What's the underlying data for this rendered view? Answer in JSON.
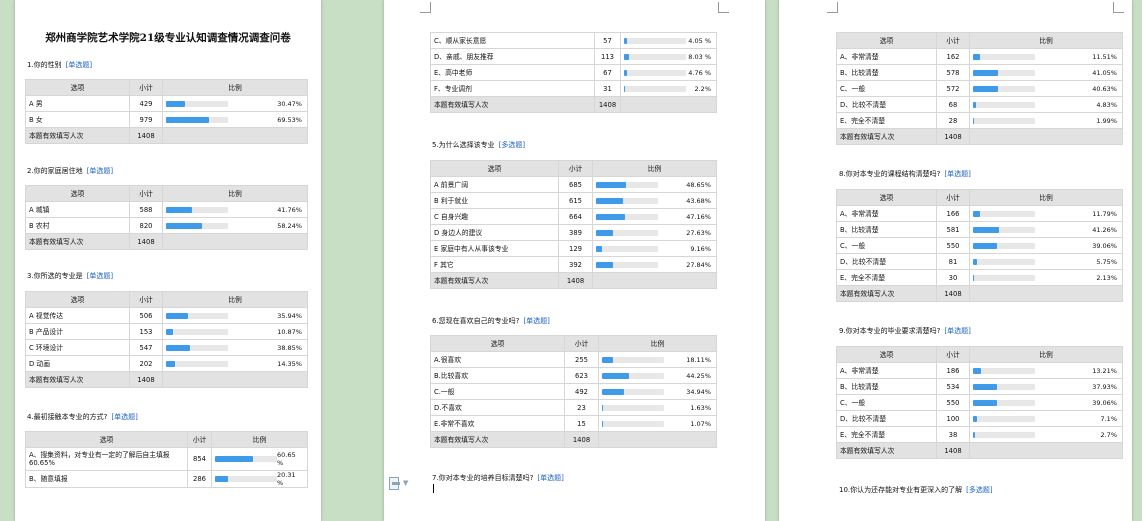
{
  "document": {
    "title": "郑州商学院艺术学院21级专业认知调查情况调查问卷",
    "header_option": "选项",
    "header_count": "小计",
    "header_ratio": "比例",
    "total_label": "本题有效填写人次"
  },
  "colors": {
    "bar_fill": "#3d9be9",
    "bar_track": "#e7e7e7",
    "tag": "#1a5fc7",
    "background": "#c9dfc5"
  },
  "icons": {
    "toolbar": "document-icon",
    "dropdown": "chevron-down-icon"
  },
  "questions": {
    "q1": {
      "title": "1.你的性别",
      "tag": "[单选题]",
      "total": "1408",
      "rows": [
        {
          "option": "A 男",
          "count": "429",
          "pct": "30.47%",
          "ratio": 30.47
        },
        {
          "option": "B 女",
          "count": "979",
          "pct": "69.53%",
          "ratio": 69.53
        }
      ]
    },
    "q2": {
      "title": "2.你的家庭居住地",
      "tag": "[单选题]",
      "total": "1408",
      "rows": [
        {
          "option": "A 城镇",
          "count": "588",
          "pct": "41.76%",
          "ratio": 41.76
        },
        {
          "option": "B 农村",
          "count": "820",
          "pct": "58.24%",
          "ratio": 58.24
        }
      ]
    },
    "q3": {
      "title": "3.你所选的专业是",
      "tag": "[单选题]",
      "total": "1408",
      "rows": [
        {
          "option": "A 视觉传达",
          "count": "506",
          "pct": "35.94%",
          "ratio": 35.94
        },
        {
          "option": "B 产品设计",
          "count": "153",
          "pct": "10.87%",
          "ratio": 10.87
        },
        {
          "option": "C 环境设计",
          "count": "547",
          "pct": "38.85%",
          "ratio": 38.85
        },
        {
          "option": "D 动画",
          "count": "202",
          "pct": "14.35%",
          "ratio": 14.35
        }
      ]
    },
    "q4": {
      "title": "4.最初接触本专业的方式?",
      "tag": "[单选题]",
      "rows": [
        {
          "option": "A、搜集资料，对专业有一定的了解后自主填报 60.65%",
          "count": "854",
          "pct": "60.65 %",
          "ratio": 60.65
        },
        {
          "option": "B、随意填报",
          "count": "286",
          "pct": "20.31 %",
          "ratio": 20.31
        }
      ],
      "rows_cont": [
        {
          "option": "C、顺从家长意愿",
          "count": "57",
          "pct": "4.05 %",
          "ratio": 4.05
        },
        {
          "option": "D、亲戚、朋友推荐",
          "count": "113",
          "pct": "8.03 %",
          "ratio": 8.03
        },
        {
          "option": "E、高中老师",
          "count": "67",
          "pct": "4.76 %",
          "ratio": 4.76
        },
        {
          "option": "F、专业调剂",
          "count": "31",
          "pct": "2.2%",
          "ratio": 2.2
        }
      ],
      "total": "1408"
    },
    "q5": {
      "title": "5.为什么选择该专业",
      "tag": "[多选题]",
      "total": "1408",
      "rows": [
        {
          "option": "A 前景广阔",
          "count": "685",
          "pct": "48.65%",
          "ratio": 48.65
        },
        {
          "option": "B 利于就业",
          "count": "615",
          "pct": "43.68%",
          "ratio": 43.68
        },
        {
          "option": "C 自身兴趣",
          "count": "664",
          "pct": "47.16%",
          "ratio": 47.16
        },
        {
          "option": "D 身边人的建议",
          "count": "389",
          "pct": "27.63%",
          "ratio": 27.63
        },
        {
          "option": "E 家庭中有人从事该专业",
          "count": "129",
          "pct": "9.16%",
          "ratio": 9.16
        },
        {
          "option": "F 其它",
          "count": "392",
          "pct": "27.84%",
          "ratio": 27.84
        }
      ]
    },
    "q6": {
      "title": "6.您现在喜欢自己的专业吗?",
      "tag": "[单选题]",
      "total": "1408",
      "rows": [
        {
          "option": "A.很喜欢",
          "count": "255",
          "pct": "18.11%",
          "ratio": 18.11
        },
        {
          "option": "B.比较喜欢",
          "count": "623",
          "pct": "44.25%",
          "ratio": 44.25
        },
        {
          "option": "C.一般",
          "count": "492",
          "pct": "34.94%",
          "ratio": 34.94
        },
        {
          "option": "D.不喜欢",
          "count": "23",
          "pct": "1.63%",
          "ratio": 1.63
        },
        {
          "option": "E.非常不喜欢",
          "count": "15",
          "pct": "1.07%",
          "ratio": 1.07
        }
      ]
    },
    "q7": {
      "title": "7.你对本专业的培养目标清楚吗?",
      "tag": "[单选题]",
      "total": "1408",
      "rows": [
        {
          "option": "A、非常清楚",
          "count": "162",
          "pct": "11.51%",
          "ratio": 11.51
        },
        {
          "option": "B、比较清楚",
          "count": "578",
          "pct": "41.05%",
          "ratio": 41.05
        },
        {
          "option": "C、一般",
          "count": "572",
          "pct": "40.63%",
          "ratio": 40.63
        },
        {
          "option": "D、比较不清楚",
          "count": "68",
          "pct": "4.83%",
          "ratio": 4.83
        },
        {
          "option": "E、完全不清楚",
          "count": "28",
          "pct": "1.99%",
          "ratio": 1.99
        }
      ]
    },
    "q8": {
      "title": "8.你对本专业的课程结构清楚吗?",
      "tag": "[单选题]",
      "total": "1408",
      "rows": [
        {
          "option": "A、非常清楚",
          "count": "166",
          "pct": "11.79%",
          "ratio": 11.79
        },
        {
          "option": "B、比较清楚",
          "count": "581",
          "pct": "41.26%",
          "ratio": 41.26
        },
        {
          "option": "C、一般",
          "count": "550",
          "pct": "39.06%",
          "ratio": 39.06
        },
        {
          "option": "D、比较不清楚",
          "count": "81",
          "pct": "5.75%",
          "ratio": 5.75
        },
        {
          "option": "E、完全不清楚",
          "count": "30",
          "pct": "2.13%",
          "ratio": 2.13
        }
      ]
    },
    "q9": {
      "title": "9.你对本专业的毕业要求清楚吗?",
      "tag": "[单选题]",
      "total": "1408",
      "rows": [
        {
          "option": "A、非常清楚",
          "count": "186",
          "pct": "13.21%",
          "ratio": 13.21
        },
        {
          "option": "B、比较清楚",
          "count": "534",
          "pct": "37.93%",
          "ratio": 37.93
        },
        {
          "option": "C、一般",
          "count": "550",
          "pct": "39.06%",
          "ratio": 39.06
        },
        {
          "option": "D、比较不清楚",
          "count": "100",
          "pct": "7.1%",
          "ratio": 7.1
        },
        {
          "option": "E、完全不清楚",
          "count": "38",
          "pct": "2.7%",
          "ratio": 2.7
        }
      ]
    },
    "q10": {
      "title": "10.你认为还存能对专业有更深入的了解",
      "tag": "[多选题]"
    }
  }
}
